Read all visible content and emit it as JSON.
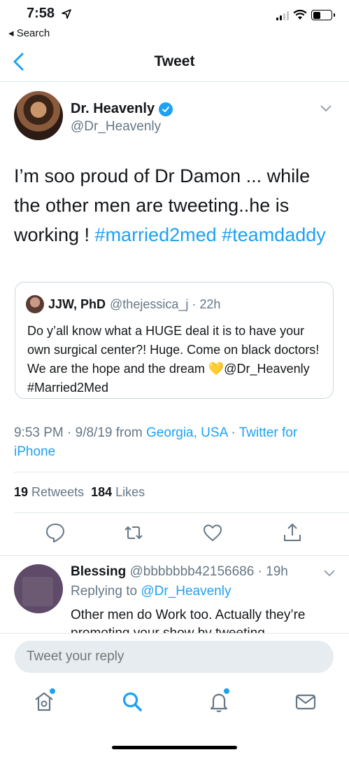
{
  "status_bar": {
    "time": "7:58",
    "back_app": "◂ Search"
  },
  "header": {
    "title": "Tweet"
  },
  "tweet": {
    "author_name": "Dr. Heavenly",
    "author_handle": "@Dr_Heavenly",
    "text_plain": "I’m soo proud of Dr Damon ...  while the other men are tweeting..he is working ! ",
    "hashtag_1": "#married2med",
    "hashtag_2": "#teamdaddy",
    "timestamp": "9:53 PM · 9/8/19 from ",
    "location": "Georgia, USA",
    "separator": " · ",
    "client": "Twitter for iPhone",
    "retweets_count": "19",
    "retweets_label": "Retweets",
    "likes_count": "184",
    "likes_label": "Likes"
  },
  "quoted": {
    "name": "JJW, PhD",
    "handle_time": "@thejessica_j · 22h",
    "text_before_emoji": "Do y’all know what a HUGE deal it is to have your own surgical center?! Huge. Come on black doctors! We are the hope and the dream ",
    "emoji": "💛",
    "text_after_emoji": "@Dr_Heavenly #Married2Med"
  },
  "reply": {
    "name": "Blessing",
    "handle_time": "@bbbbbbb42156686 · 19h",
    "replying_to_label": "Replying to ",
    "replying_to_handle": "@Dr_Heavenly",
    "text": "Other men do Work too. Actually they’re promoting your show by tweeting"
  },
  "composer": {
    "placeholder": "Tweet your reply"
  },
  "tabs": [
    "home-icon",
    "search-icon",
    "notifications-icon",
    "messages-icon"
  ],
  "colors": {
    "accent": "#1da1f2",
    "secondary_text": "#657786"
  }
}
